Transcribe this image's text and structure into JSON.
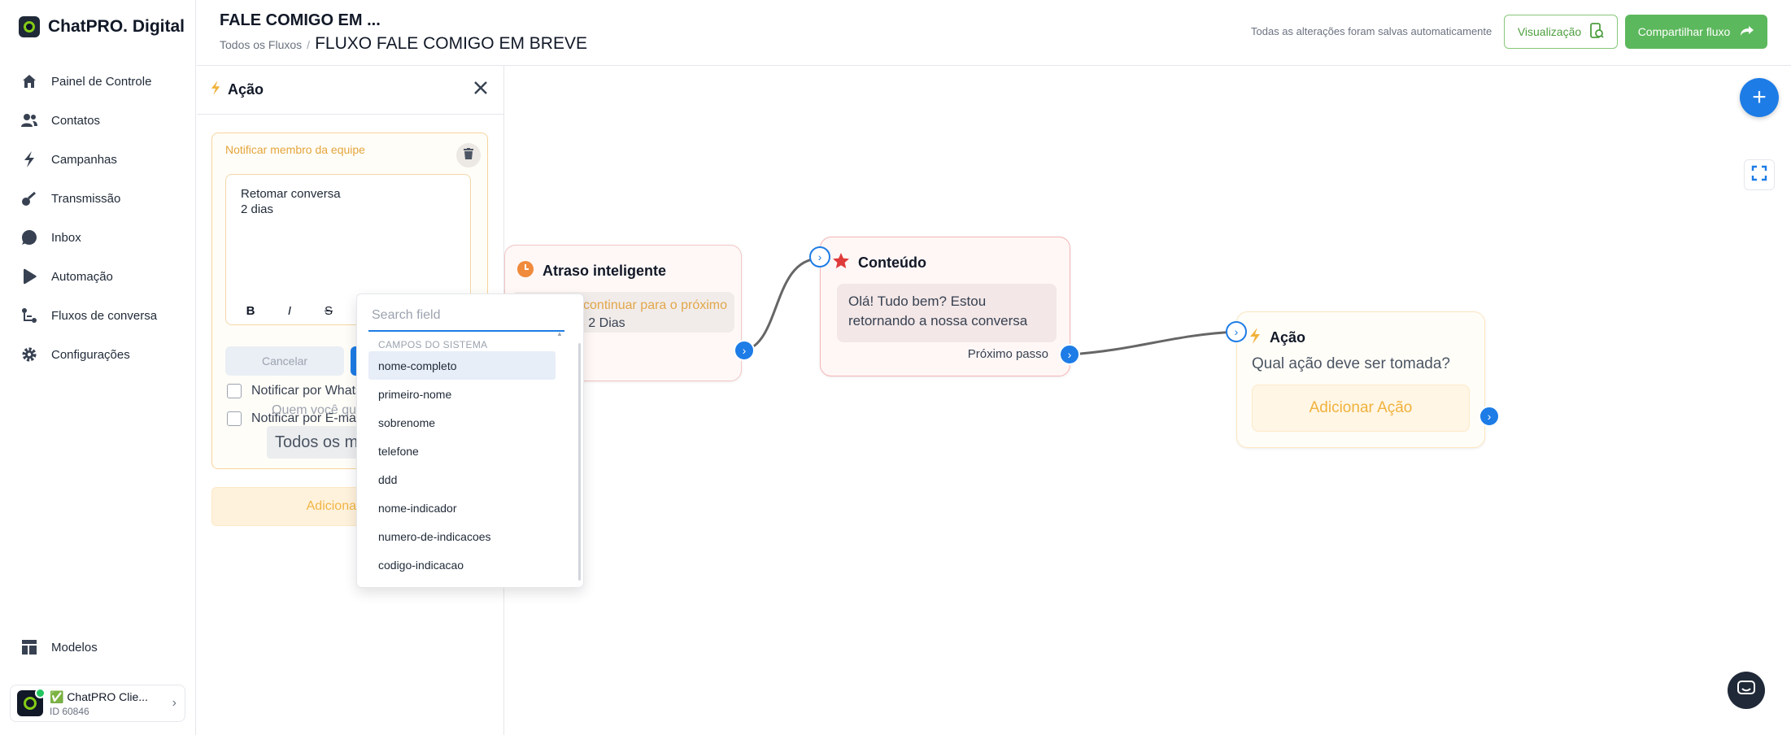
{
  "brand": {
    "name": "ChatPRO. Digital"
  },
  "sidebar": {
    "items": [
      {
        "label": "Painel de Controle",
        "icon": "home-icon"
      },
      {
        "label": "Contatos",
        "icon": "users-icon"
      },
      {
        "label": "Campanhas",
        "icon": "lightning-icon"
      },
      {
        "label": "Transmissão",
        "icon": "broadcast-icon"
      },
      {
        "label": "Inbox",
        "icon": "chat-bubble-icon"
      },
      {
        "label": "Automação",
        "icon": "play-icon"
      },
      {
        "label": "Fluxos de conversa",
        "icon": "flow-icon"
      },
      {
        "label": "Configurações",
        "icon": "gear-icon"
      }
    ],
    "bottom": {
      "label": "Modelos",
      "icon": "templates-icon"
    },
    "account": {
      "name": "✅ ChatPRO Clie...",
      "id": "ID 60846"
    }
  },
  "header": {
    "title": "FALE COMIGO EM ...",
    "breadcrumb_root": "Todos os Fluxos",
    "breadcrumb_sep": "/",
    "breadcrumb_current": "FLUXO FALE COMIGO EM BREVE",
    "autosave": "Todas as alterações foram salvas automaticamente",
    "preview_label": "Visualização",
    "share_label": "Compartilhar fluxo"
  },
  "panel": {
    "title": "Ação",
    "card_label": "Notificar membro da equipe",
    "editor_line1": "Retomar conversa",
    "editor_line2": "2 dias",
    "toolbar": {
      "bold": "B",
      "italic": "I",
      "strike": "S",
      "variable": "{}"
    },
    "cancel_label": "Cancelar",
    "whatsapp_label": "Notificar por Whatsapp",
    "email_label": "Notificar por E-mail",
    "who_label": "Quem você quer notificar?",
    "who_value": "Todos os membros",
    "add_action_label": "Adicionar Ação"
  },
  "dropdown": {
    "placeholder": "Search field",
    "group_label": "CAMPOS DO SISTEMA",
    "items": [
      "nome-completo",
      "primeiro-nome",
      "sobrenome",
      "telefone",
      "ddd",
      "nome-indicador",
      "numero-de-indicacoes",
      "codigo-indicacao"
    ]
  },
  "nodes": {
    "delay": {
      "title": "Atraso inteligente",
      "text": "O fluxo vai continuar para o próximo passo após",
      "value": "2 Dias"
    },
    "content": {
      "title": "Conteúdo",
      "message": "Olá! Tudo bem? Estou retornando a nossa conversa",
      "next": "Próximo passo"
    },
    "action": {
      "title": "Ação",
      "question": "Qual ação deve ser tomada?",
      "add_label": "Adicionar Ação"
    }
  },
  "colors": {
    "accent_blue": "#1d7ce6",
    "brand_green": "#5cb85c",
    "warning_orange": "#e4a53b",
    "danger_red": "#e03b3b"
  }
}
